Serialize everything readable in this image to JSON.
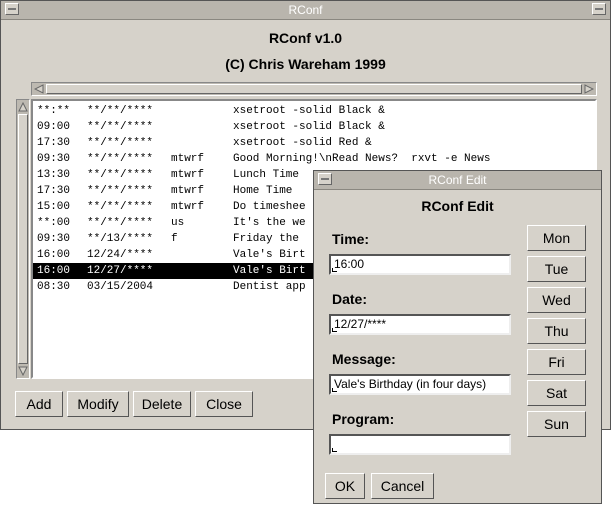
{
  "main_window": {
    "title": "RConf",
    "heading": "RConf v1.0",
    "copyright": "(C) Chris Wareham 1999",
    "entries": [
      {
        "time": "**:**",
        "date": "**/**/****",
        "days": "",
        "command": "xsetroot -solid Black &"
      },
      {
        "time": "09:00",
        "date": "**/**/****",
        "days": "",
        "command": "xsetroot -solid Black &"
      },
      {
        "time": "17:30",
        "date": "**/**/****",
        "days": "",
        "command": "xsetroot -solid Red &"
      },
      {
        "time": "09:30",
        "date": "**/**/****",
        "days": "mtwrf",
        "command": "Good Morning!\\nRead News?  rxvt -e News"
      },
      {
        "time": "13:30",
        "date": "**/**/****",
        "days": "mtwrf",
        "command": "Lunch Time"
      },
      {
        "time": "17:30",
        "date": "**/**/****",
        "days": "mtwrf",
        "command": "Home Time"
      },
      {
        "time": "15:00",
        "date": "**/**/****",
        "days": "mtwrf",
        "command": "Do timeshee"
      },
      {
        "time": "**:00",
        "date": "**/**/****",
        "days": "us",
        "command": "It's the we"
      },
      {
        "time": "09:30",
        "date": "**/13/****",
        "days": "f",
        "command": "Friday the"
      },
      {
        "time": "16:00",
        "date": "12/24/****",
        "days": "",
        "command": "Vale's Birt"
      },
      {
        "time": "16:00",
        "date": "12/27/****",
        "days": "",
        "command": "Vale's Birt"
      },
      {
        "time": "08:30",
        "date": "03/15/2004",
        "days": "",
        "command": "Dentist app"
      }
    ],
    "selected_index": 10,
    "buttons": {
      "add": "Add",
      "modify": "Modify",
      "delete": "Delete",
      "close": "Close"
    }
  },
  "edit_dialog": {
    "title": "RConf Edit",
    "heading": "RConf Edit",
    "time_label": "Time:",
    "time_value": "16:00",
    "date_label": "Date:",
    "date_value": "12/27/****",
    "message_label": "Message:",
    "message_value": "Vale's Birthday (in four days)",
    "program_label": "Program:",
    "program_value": "",
    "days": [
      "Mon",
      "Tue",
      "Wed",
      "Thu",
      "Fri",
      "Sat",
      "Sun"
    ],
    "ok": "OK",
    "cancel": "Cancel"
  }
}
